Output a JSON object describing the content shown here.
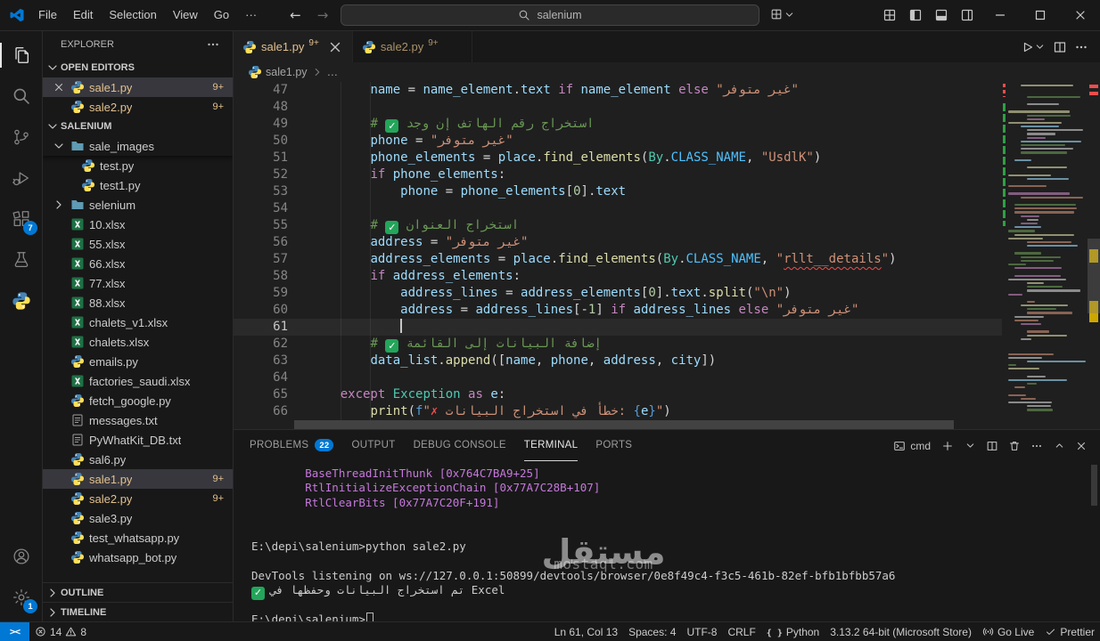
{
  "title_bar": {
    "menus": [
      "File",
      "Edit",
      "Selection",
      "View",
      "Go"
    ],
    "menu_overflow": "···",
    "search_value": "salenium"
  },
  "activity_bar": {
    "top": [
      {
        "icon": "explorer",
        "name": "explorer",
        "active": true
      },
      {
        "icon": "search",
        "name": "search"
      },
      {
        "icon": "scm",
        "name": "source-control"
      },
      {
        "icon": "debug",
        "name": "run-and-debug"
      },
      {
        "icon": "extensions",
        "name": "extensions",
        "badge": "7"
      },
      {
        "icon": "testing",
        "name": "testing"
      },
      {
        "icon": "python",
        "name": "python-env"
      }
    ],
    "bottom": [
      {
        "icon": "account",
        "name": "accounts"
      },
      {
        "icon": "gear",
        "name": "settings",
        "badge": "1"
      }
    ]
  },
  "sidebar": {
    "title": "EXPLORER",
    "open_editors_label": "OPEN EDITORS",
    "open_editors": [
      {
        "name": "sale1.py",
        "icon": "python",
        "badge": "9+",
        "selected": true,
        "close": true,
        "modified": true
      },
      {
        "name": "sale2.py",
        "icon": "python",
        "badge": "9+",
        "modified": true
      }
    ],
    "folder_label": "SALENIUM",
    "tree": [
      {
        "name": "sale_images",
        "type": "folder-open",
        "indent": 0
      },
      {
        "name": "test.py",
        "icon": "python",
        "indent": 1
      },
      {
        "name": "test1.py",
        "icon": "python",
        "indent": 1
      },
      {
        "name": "selenium",
        "type": "folder",
        "indent": 0
      },
      {
        "name": "10.xlsx",
        "icon": "excel",
        "indent": 0
      },
      {
        "name": "55.xlsx",
        "icon": "excel",
        "indent": 0
      },
      {
        "name": "66.xlsx",
        "icon": "excel",
        "indent": 0
      },
      {
        "name": "77.xlsx",
        "icon": "excel",
        "indent": 0
      },
      {
        "name": "88.xlsx",
        "icon": "excel",
        "indent": 0
      },
      {
        "name": "chalets_v1.xlsx",
        "icon": "excel",
        "indent": 0
      },
      {
        "name": "chalets.xlsx",
        "icon": "excel",
        "indent": 0
      },
      {
        "name": "emails.py",
        "icon": "python",
        "indent": 0
      },
      {
        "name": "factories_saudi.xlsx",
        "icon": "excel",
        "indent": 0
      },
      {
        "name": "fetch_google.py",
        "icon": "python",
        "indent": 0
      },
      {
        "name": "messages.txt",
        "icon": "text",
        "indent": 0
      },
      {
        "name": "PyWhatKit_DB.txt",
        "icon": "text",
        "indent": 0
      },
      {
        "name": "sal6.py",
        "icon": "python",
        "indent": 0
      },
      {
        "name": "sale1.py",
        "icon": "python",
        "indent": 0,
        "badge": "9+",
        "selected": true,
        "modified": true
      },
      {
        "name": "sale2.py",
        "icon": "python",
        "indent": 0,
        "badge": "9+",
        "modified": true
      },
      {
        "name": "sale3.py",
        "icon": "python",
        "indent": 0
      },
      {
        "name": "test_whatsapp.py",
        "icon": "python",
        "indent": 0
      },
      {
        "name": "whatsapp_bot.py",
        "icon": "python",
        "indent": 0
      }
    ],
    "outline_label": "OUTLINE",
    "timeline_label": "TIMELINE"
  },
  "editor": {
    "tabs": [
      {
        "name": "sale1.py",
        "icon": "python",
        "badge": "9+",
        "active": true,
        "close": true
      },
      {
        "name": "sale2.py",
        "icon": "python",
        "badge": "9+"
      }
    ],
    "breadcrumb": [
      "sale1.py",
      "…"
    ],
    "cursor": {
      "line": 61,
      "col": 13
    },
    "lines": [
      {
        "n": 47,
        "t": [
          [
            "        ",
            "p"
          ],
          [
            "name",
            "v"
          ],
          [
            " = ",
            "p"
          ],
          [
            "name_element",
            "v"
          ],
          [
            ".",
            "p"
          ],
          [
            "text",
            "v"
          ],
          [
            " ",
            "p"
          ],
          [
            "if",
            "k"
          ],
          [
            " ",
            "p"
          ],
          [
            "name_element",
            "v"
          ],
          [
            " ",
            "p"
          ],
          [
            "else",
            "k"
          ],
          [
            " ",
            "p"
          ],
          [
            "\"غير متوفر\"",
            "s"
          ]
        ]
      },
      {
        "n": 48,
        "t": []
      },
      {
        "n": 49,
        "t": [
          [
            "        ",
            "p"
          ],
          [
            "# ",
            "c"
          ],
          [
            "✓",
            "eck"
          ],
          [
            " استخراج رقم الهاتف إن وجد",
            "c"
          ]
        ]
      },
      {
        "n": 50,
        "t": [
          [
            "        ",
            "p"
          ],
          [
            "phone",
            "v"
          ],
          [
            " = ",
            "p"
          ],
          [
            "\"غير متوفر\"",
            "s"
          ]
        ]
      },
      {
        "n": 51,
        "t": [
          [
            "        ",
            "p"
          ],
          [
            "phone_elements",
            "v"
          ],
          [
            " = ",
            "p"
          ],
          [
            "place",
            "v"
          ],
          [
            ".",
            "p"
          ],
          [
            "find_elements",
            "f"
          ],
          [
            "(",
            "p"
          ],
          [
            "By",
            "cl"
          ],
          [
            ".",
            "p"
          ],
          [
            "CLASS_NAME",
            "co"
          ],
          [
            ", ",
            "p"
          ],
          [
            "\"UsdlK\"",
            "s"
          ],
          [
            ")",
            "p"
          ]
        ]
      },
      {
        "n": 52,
        "t": [
          [
            "        ",
            "p"
          ],
          [
            "if",
            "k"
          ],
          [
            " ",
            "p"
          ],
          [
            "phone_elements",
            "v"
          ],
          [
            ":",
            "p"
          ]
        ]
      },
      {
        "n": 53,
        "t": [
          [
            "            ",
            "p"
          ],
          [
            "phone",
            "v"
          ],
          [
            " = ",
            "p"
          ],
          [
            "phone_elements",
            "v"
          ],
          [
            "[",
            "p"
          ],
          [
            "0",
            "n"
          ],
          [
            "]",
            "p"
          ],
          [
            ".",
            "p"
          ],
          [
            "text",
            "v"
          ]
        ]
      },
      {
        "n": 54,
        "t": []
      },
      {
        "n": 55,
        "t": [
          [
            "        ",
            "p"
          ],
          [
            "# ",
            "c"
          ],
          [
            "✓",
            "eck"
          ],
          [
            " استخراج العنوان",
            "c"
          ]
        ]
      },
      {
        "n": 56,
        "t": [
          [
            "        ",
            "p"
          ],
          [
            "address",
            "v"
          ],
          [
            " = ",
            "p"
          ],
          [
            "\"غير متوفر\"",
            "s"
          ]
        ]
      },
      {
        "n": 57,
        "t": [
          [
            "        ",
            "p"
          ],
          [
            "address_elements",
            "v"
          ],
          [
            " = ",
            "p"
          ],
          [
            "place",
            "v"
          ],
          [
            ".",
            "p"
          ],
          [
            "find_elements",
            "f"
          ],
          [
            "(",
            "p"
          ],
          [
            "By",
            "cl"
          ],
          [
            ".",
            "p"
          ],
          [
            "CLASS_NAME",
            "co"
          ],
          [
            ", ",
            "p"
          ],
          [
            "\"",
            "s"
          ],
          [
            "rllt__details",
            "se"
          ],
          [
            "\"",
            "s"
          ],
          [
            ")",
            "p"
          ]
        ]
      },
      {
        "n": 58,
        "t": [
          [
            "        ",
            "p"
          ],
          [
            "if",
            "k"
          ],
          [
            " ",
            "p"
          ],
          [
            "address_elements",
            "v"
          ],
          [
            ":",
            "p"
          ]
        ]
      },
      {
        "n": 59,
        "t": [
          [
            "            ",
            "p"
          ],
          [
            "address_lines",
            "v"
          ],
          [
            " = ",
            "p"
          ],
          [
            "address_elements",
            "v"
          ],
          [
            "[",
            "p"
          ],
          [
            "0",
            "n"
          ],
          [
            "]",
            "p"
          ],
          [
            ".",
            "p"
          ],
          [
            "text",
            "v"
          ],
          [
            ".",
            "p"
          ],
          [
            "split",
            "f"
          ],
          [
            "(",
            "p"
          ],
          [
            "\"\\n\"",
            "s"
          ],
          [
            ")",
            "p"
          ]
        ]
      },
      {
        "n": 60,
        "t": [
          [
            "            ",
            "p"
          ],
          [
            "address",
            "v"
          ],
          [
            " = ",
            "p"
          ],
          [
            "address_lines",
            "v"
          ],
          [
            "[",
            "p"
          ],
          [
            "-",
            "p"
          ],
          [
            "1",
            "n"
          ],
          [
            "]",
            "p"
          ],
          [
            " ",
            "p"
          ],
          [
            "if",
            "k"
          ],
          [
            " ",
            "p"
          ],
          [
            "address_lines",
            "v"
          ],
          [
            " ",
            "p"
          ],
          [
            "else",
            "k"
          ],
          [
            " ",
            "p"
          ],
          [
            "\"غير متوفر\"",
            "s"
          ]
        ]
      },
      {
        "n": 61,
        "t": [
          [
            "            ",
            "p"
          ]
        ],
        "cursor": true,
        "active": true
      },
      {
        "n": 62,
        "t": [
          [
            "        ",
            "p"
          ],
          [
            "# ",
            "c"
          ],
          [
            "✓",
            "eck"
          ],
          [
            " إضافة البيانات إلى القائمة",
            "c"
          ]
        ]
      },
      {
        "n": 63,
        "t": [
          [
            "        ",
            "p"
          ],
          [
            "data_list",
            "v"
          ],
          [
            ".",
            "p"
          ],
          [
            "append",
            "f"
          ],
          [
            "([",
            "p"
          ],
          [
            "name",
            "v"
          ],
          [
            ", ",
            "p"
          ],
          [
            "phone",
            "v"
          ],
          [
            ", ",
            "p"
          ],
          [
            "address",
            "v"
          ],
          [
            ", ",
            "p"
          ],
          [
            "city",
            "v"
          ],
          [
            "])",
            "p"
          ]
        ]
      },
      {
        "n": 64,
        "t": []
      },
      {
        "n": 65,
        "t": [
          [
            "    ",
            "p"
          ],
          [
            "except",
            "k"
          ],
          [
            " ",
            "p"
          ],
          [
            "Exception",
            "cl"
          ],
          [
            " ",
            "p"
          ],
          [
            "as",
            "k"
          ],
          [
            " ",
            "p"
          ],
          [
            "e",
            "v"
          ],
          [
            ":",
            "p"
          ]
        ]
      },
      {
        "n": 66,
        "t": [
          [
            "        ",
            "p"
          ],
          [
            "print",
            "f"
          ],
          [
            "(",
            "p"
          ],
          [
            "f",
            "fp"
          ],
          [
            "\"",
            "s"
          ],
          [
            "✗",
            "ex"
          ],
          [
            " خطأ في استخراج البيانات: ",
            "s"
          ],
          [
            "{",
            "fp"
          ],
          [
            "e",
            "v"
          ],
          [
            "}",
            "fp"
          ],
          [
            "\"",
            "s"
          ],
          [
            ")",
            "p"
          ]
        ]
      }
    ]
  },
  "panel": {
    "tabs": [
      {
        "label": "PROBLEMS",
        "badge": "22"
      },
      {
        "label": "OUTPUT"
      },
      {
        "label": "DEBUG CONSOLE"
      },
      {
        "label": "TERMINAL",
        "active": true
      },
      {
        "label": "PORTS"
      }
    ],
    "shell_label": "cmd",
    "terminal": [
      {
        "text": "        BaseThreadInitThunk [0x764C7BA9+25]",
        "color": "magenta"
      },
      {
        "text": "        RtlInitializeExceptionChain [0x77A7C28B+107]",
        "color": "magenta"
      },
      {
        "text": "        RtlClearBits [0x77A7C20F+191]",
        "color": "magenta"
      },
      {
        "text": ""
      },
      {
        "text": ""
      },
      {
        "text": "E:\\depi\\salenium>python sale2.py"
      },
      {
        "text": ""
      },
      {
        "text": "DevTools listening on ws://127.0.0.1:50899/devtools/browser/0e8f49c4-f3c5-461b-82ef-bfb1bfbb57a6"
      },
      {
        "icon": "check",
        "text": "تم استخراج البيانات وحفظها في Excel"
      },
      {
        "text": ""
      },
      {
        "text": "E:\\depi\\salenium>",
        "cursor": true
      }
    ]
  },
  "status_bar": {
    "remote_glyph": "><",
    "problems": {
      "errors": "14",
      "warnings": "8"
    },
    "right": [
      {
        "name": "cursor-position",
        "label": "Ln 61, Col 13"
      },
      {
        "name": "indentation",
        "label": "Spaces: 4"
      },
      {
        "name": "encoding",
        "label": "UTF-8"
      },
      {
        "name": "eol",
        "label": "CRLF"
      },
      {
        "name": "language-mode",
        "label": "Python",
        "icon": "braces"
      },
      {
        "name": "python-interpreter",
        "label": "3.13.2 64-bit (Microsoft Store)"
      },
      {
        "name": "go-live",
        "label": "Go Live",
        "icon": "broadcast"
      },
      {
        "name": "prettier",
        "label": "Prettier",
        "icon": "check"
      }
    ]
  },
  "watermark": {
    "line1": "مستقل",
    "line2": "mostaql.com"
  }
}
